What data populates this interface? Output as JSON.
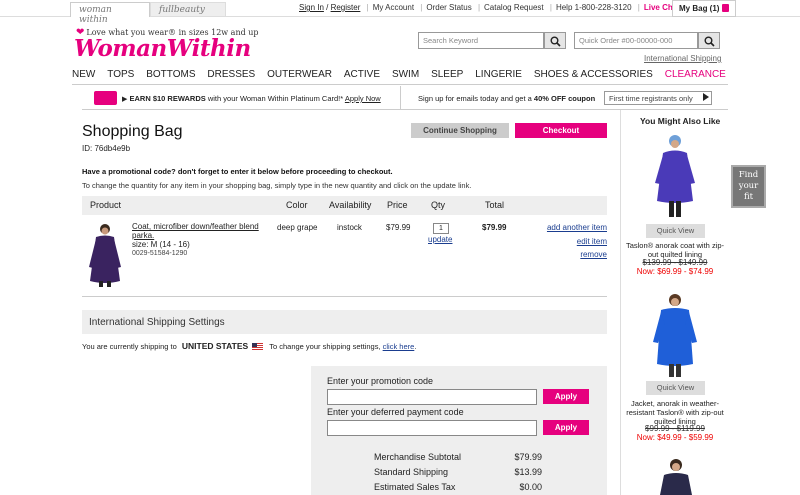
{
  "top": {
    "brand_tabs": [
      "woman within",
      "fullbeauty"
    ],
    "utility_links": {
      "sign_in": "Sign In",
      "register": "Register",
      "my_account": "My Account",
      "order_status": "Order Status",
      "catalog_request": "Catalog Request",
      "help": "Help 1-800-228-3120",
      "live_chat": "Live Chat",
      "my_bag": "My Bag (1)"
    }
  },
  "header": {
    "tagline": "Love what you wear® in sizes 12w and up",
    "logo": "WomanWithin",
    "search_placeholder": "Search Keyword",
    "quick_order_placeholder": "Quick Order #00-00000-000",
    "intl_shipping_link": "International Shipping"
  },
  "nav": [
    "NEW",
    "TOPS",
    "BOTTOMS",
    "DRESSES",
    "OUTERWEAR",
    "ACTIVE",
    "SWIM",
    "SLEEP",
    "LINGERIE",
    "SHOES & ACCESSORIES",
    "CLEARANCE"
  ],
  "promo_strip": {
    "rewards_bold": "EARN $10 REWARDS",
    "rewards_text": " with your Woman Within Platinum Card!*",
    "apply_now": "Apply Now",
    "email_text_1": "Sign up for emails today and get a ",
    "email_bold": "40% OFF coupon",
    "email_input": "First time registrants only"
  },
  "bag": {
    "title": "Shopping Bag",
    "id_label": "ID: 76db4e9b",
    "continue_btn": "Continue Shopping",
    "checkout_btn": "Checkout",
    "promo_note": "Have a promotional code? don't forget to enter it below before proceeding to checkout.",
    "qty_note": "To change the quantity for any item in your shopping bag, simply type in the new quantity and click on the update link.",
    "columns": [
      "Product",
      "Color",
      "Availability",
      "Price",
      "Qty",
      "Total"
    ],
    "item": {
      "name_line1": "Coat, microfiber down/feather blend",
      "name_line2": "parka.",
      "size": "size: M (14 - 16)",
      "sku": "0029-51584-1290",
      "color": "deep grape",
      "availability": "instock",
      "price": "$79.99",
      "qty": "1",
      "update": "update",
      "total": "$79.99",
      "add_another": "add another item",
      "edit": "edit item",
      "remove": "remove"
    }
  },
  "intl": {
    "section_title": "International Shipping Settings",
    "shipping_to": "You are currently shipping to",
    "country": "UNITED STATES",
    "change_text": "To change your shipping settings, ",
    "click_here": "click here"
  },
  "promo_box": {
    "promo_label": "Enter your promotion code",
    "deferred_label": "Enter your deferred payment code",
    "apply": "Apply",
    "summary": [
      {
        "label": "Merchandise Subtotal",
        "value": "$79.99"
      },
      {
        "label": "Standard Shipping",
        "value": "$13.99"
      },
      {
        "label": "Estimated Sales Tax",
        "value": "$0.00"
      }
    ]
  },
  "recommendations": {
    "title": "You Might Also Like",
    "quick_view": "Quick View",
    "items": [
      {
        "name": "Taslon® anorak coat with zip-out quilted lining",
        "old": "$139.99 - $149.99",
        "now": "Now: $69.99 - $74.99"
      },
      {
        "name": "Jacket, anorak in weather-resistant Taslon® with zip-out quilted lining",
        "old": "$99.99 - $119.99",
        "now": "Now: $49.99 - $59.99"
      }
    ]
  },
  "find_fit": "Find your fit",
  "colors": {
    "accent": "#e6007e",
    "sale_red": "#ee0000"
  }
}
